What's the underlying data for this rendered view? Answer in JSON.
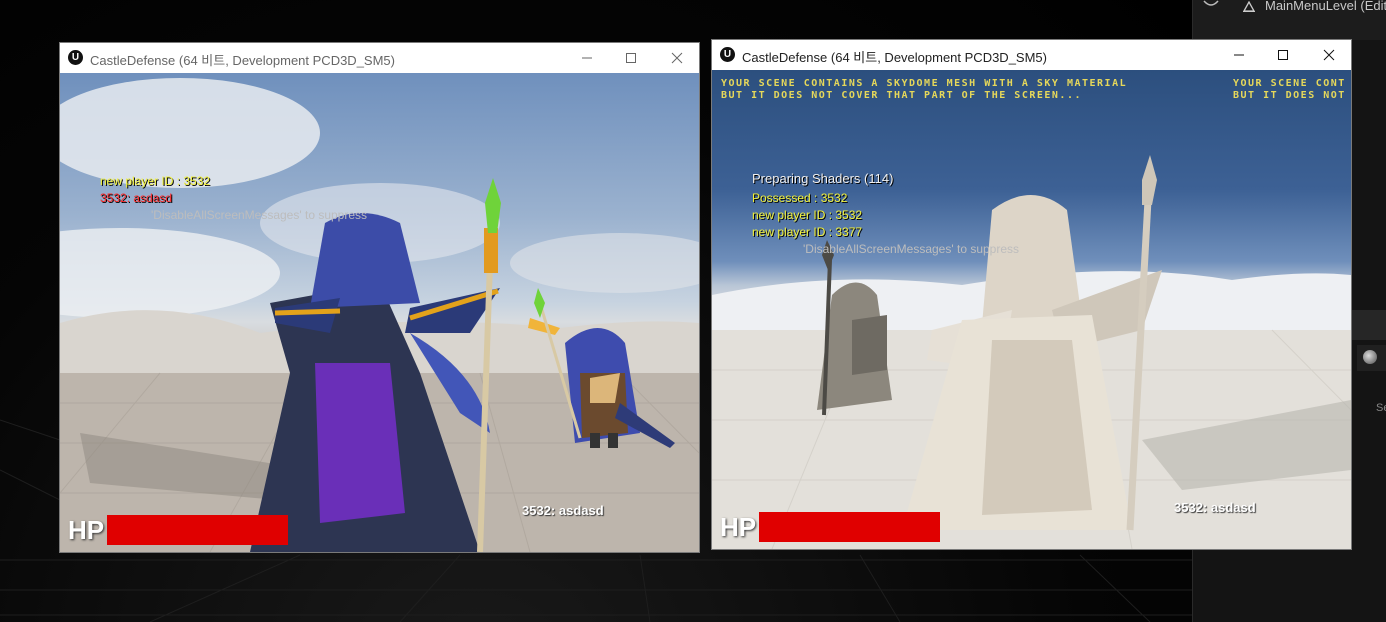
{
  "editor": {
    "level_name": "MainMenuLevel (Edito",
    "side_text": "Se"
  },
  "window_left": {
    "title": "CastleDefense (64 비트, Development PCD3D_SM5)",
    "messages": {
      "new_player": "new player ID : 3532",
      "chat": "3532: asdasd",
      "suppress": "'DisableAllScreenMessages' to suppress"
    },
    "hud": {
      "hp_label": "HP",
      "hp_fraction": 1.0,
      "player_tag": "3532: asdasd"
    }
  },
  "window_right": {
    "title": "CastleDefense (64 비트, Development PCD3D_SM5)",
    "skydome_warning": "YOUR SCENE CONTAINS A SKYDOME MESH WITH A SKY MATERIAL\nBUT IT DOES NOT COVER THAT PART OF THE SCREEN...",
    "skydome_warning_clipped": "YOUR SCENE CONT\nBUT IT DOES NOT",
    "messages": {
      "shaders": "Preparing Shaders (114)",
      "possessed": "Possessed : 3532",
      "new_player_1": "new player ID : 3532",
      "new_player_2": "new player ID : 3377",
      "suppress": "'DisableAllScreenMessages' to suppress"
    },
    "hud": {
      "hp_label": "HP",
      "hp_fraction": 1.0,
      "player_tag": "3532: asdasd"
    }
  },
  "colors": {
    "hp_bar": "#e00000",
    "debug_yellow": "#f2f23c",
    "debug_red": "#ff2a2a"
  },
  "icons": [
    "unreal-logo-icon",
    "minimize-icon",
    "maximize-icon",
    "close-icon",
    "eye-icon",
    "level-icon",
    "globe-icon"
  ]
}
